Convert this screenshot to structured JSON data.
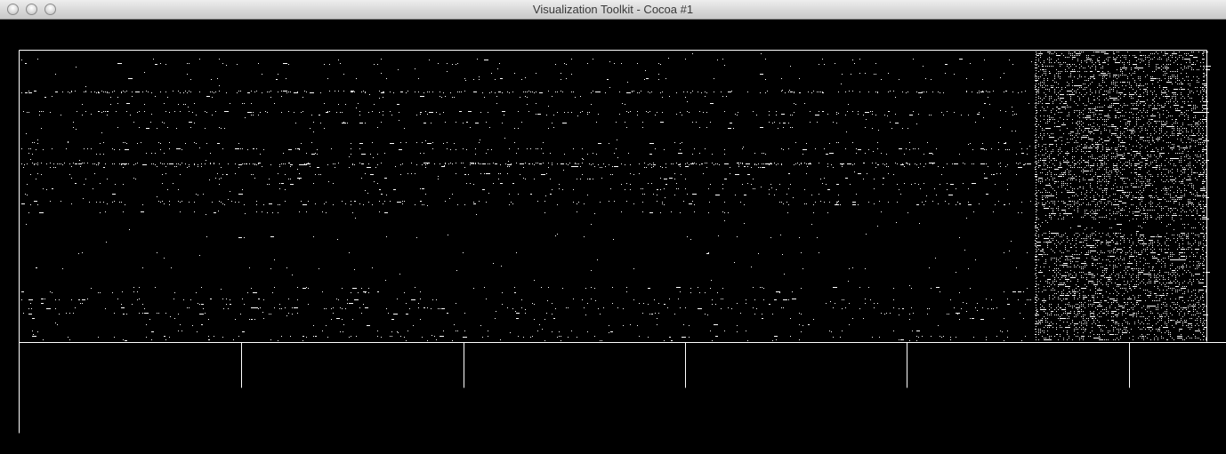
{
  "window": {
    "title": "Visualization Toolkit - Cocoa #1",
    "buttons": [
      {
        "name": "close-button",
        "color": "#c8c8c8"
      },
      {
        "name": "minimize-button",
        "color": "#c8c8c8"
      },
      {
        "name": "zoom-button",
        "color": "#c8c8c8"
      }
    ]
  },
  "render": {
    "background": "#000000",
    "foreground": "#ffffff",
    "content": "sparse matrix view: white dot pattern inside a white frame with a tick-marked axis below"
  }
}
